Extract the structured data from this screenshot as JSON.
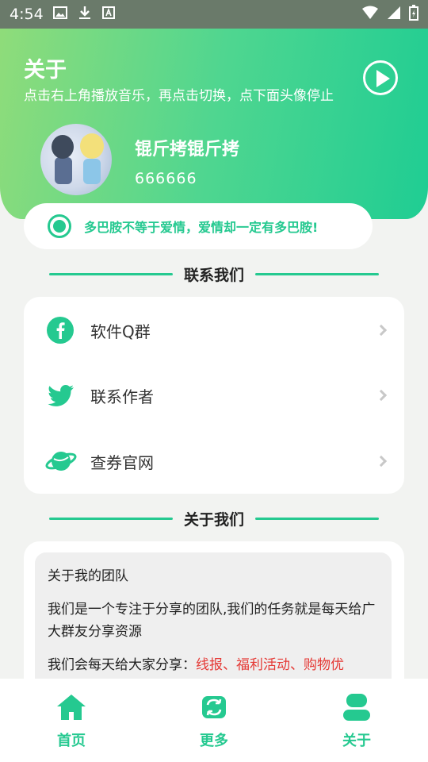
{
  "status_bar": {
    "time": "4:54"
  },
  "header": {
    "title": "关于",
    "subtitle": "点击右上角播放音乐，再点击切换，点下面头像停止",
    "username": "锟斤拷锟斤拷",
    "user_id": "666666"
  },
  "motto": "多巴胺不等于爱情，爱情却一定有多巴胺!",
  "contact": {
    "title": "联系我们",
    "items": [
      {
        "label": "软件Q群",
        "icon": "facebook-icon"
      },
      {
        "label": "联系作者",
        "icon": "twitter-icon"
      },
      {
        "label": "查券官网",
        "icon": "planet-icon"
      }
    ]
  },
  "about": {
    "title": "关于我们",
    "p1": "关于我的团队",
    "p2": "我们是一个专注于分享的团队,我们的任务就是每天给广大群友分享资源",
    "p3_prefix": "我们会每天给大家分享：",
    "p3_highlight": "线报、福利活动、购物优"
  },
  "tabbar": {
    "tabs": [
      {
        "label": "首页",
        "icon": "home-icon"
      },
      {
        "label": "更多",
        "icon": "refresh-icon"
      },
      {
        "label": "关于",
        "icon": "user-icon"
      }
    ]
  },
  "colors": {
    "accent": "#25c990",
    "highlight": "#e53935"
  }
}
